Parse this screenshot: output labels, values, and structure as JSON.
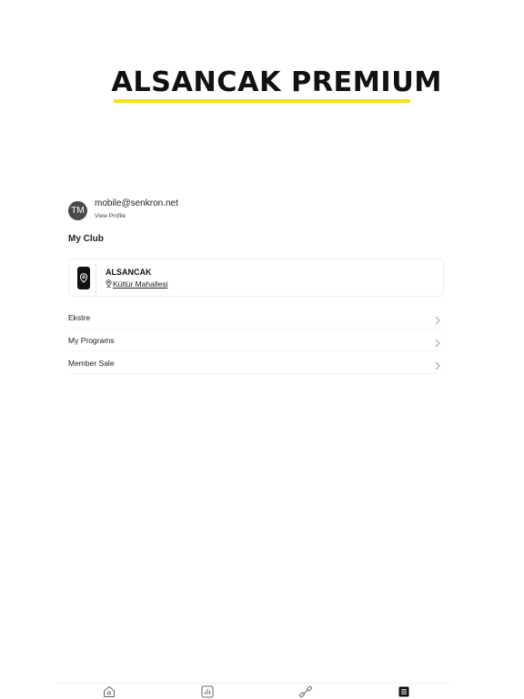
{
  "logo": {
    "text": "ALSANCAK PREMIUM",
    "accent_color": "#f2e31b"
  },
  "profile": {
    "initials": "TM",
    "email": "mobile@senkron.net",
    "view_profile_label": "View Profile"
  },
  "my_club": {
    "title": "My Club",
    "club_name": "ALSANCAK",
    "location": "Kültür Mahallesi",
    "icon": "map-pin-icon"
  },
  "menu": [
    {
      "label": "Ekstre",
      "icon": "chevron-right-icon"
    },
    {
      "label": "My Programs",
      "icon": "chevron-right-icon"
    },
    {
      "label": "Member Sale",
      "icon": "chevron-right-icon"
    }
  ],
  "tab_bar": [
    {
      "icon": "home-icon",
      "active": false
    },
    {
      "icon": "bar-chart-icon",
      "active": false
    },
    {
      "icon": "dumbbell-icon",
      "active": false
    },
    {
      "icon": "list-icon",
      "active": true
    }
  ]
}
